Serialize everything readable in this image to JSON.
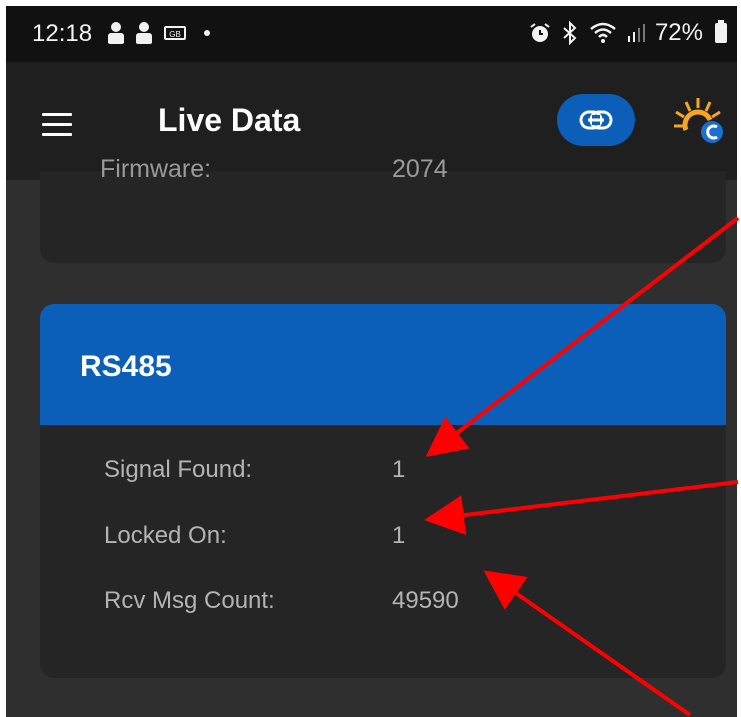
{
  "status_bar": {
    "time": "12:18",
    "battery": "72%",
    "chip_label": "GB"
  },
  "app_bar": {
    "title": "Live Data"
  },
  "top_card": {
    "label": "Firmware:",
    "value": "2074"
  },
  "rs485": {
    "title": "RS485",
    "rows": [
      {
        "label": "Signal Found:",
        "value": "1"
      },
      {
        "label": "Locked On:",
        "value": "1"
      },
      {
        "label": "Rcv Msg Count:",
        "value": "49590"
      }
    ]
  },
  "colors": {
    "accent": "#0b5fb8",
    "background": "#2f2f2f",
    "card": "#252525",
    "annotation": "#ff0000"
  }
}
